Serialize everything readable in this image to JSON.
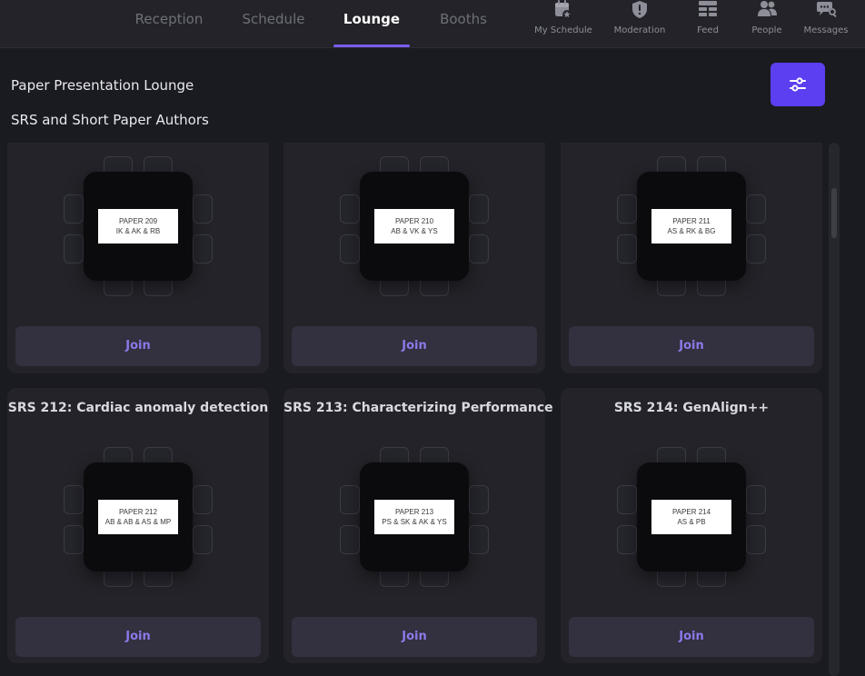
{
  "nav": {
    "tabs": [
      {
        "label": "Reception"
      },
      {
        "label": "Schedule"
      },
      {
        "label": "Lounge"
      },
      {
        "label": "Booths"
      }
    ],
    "buttons": [
      {
        "label": "My Schedule",
        "icon": "calendar-star-icon"
      },
      {
        "label": "Moderation",
        "icon": "shield-alert-icon"
      },
      {
        "label": "Feed",
        "icon": "feed-icon"
      },
      {
        "label": "People",
        "icon": "people-icon"
      },
      {
        "label": "Messages",
        "icon": "messages-icon"
      }
    ]
  },
  "header": {
    "title": "Paper Presentation Lounge",
    "subtitle": "SRS and Short Paper Authors",
    "filter_icon": "sliders-icon",
    "accent": "#5b3ff0"
  },
  "tables": [
    {
      "title": "",
      "tag_line1": "PAPER 209",
      "tag_line2": "IK & AK & RB",
      "join": "Join"
    },
    {
      "title": "",
      "tag_line1": "PAPER 210",
      "tag_line2": "AB & VK & YS",
      "join": "Join"
    },
    {
      "title": "",
      "tag_line1": "PAPER 211",
      "tag_line2": "AS & RK & BG",
      "join": "Join"
    },
    {
      "title": "SRS 212: Cardiac anomaly detection",
      "tag_line1": "PAPER 212",
      "tag_line2": "AB & AB & AS & MP",
      "join": "Join"
    },
    {
      "title": "SRS 213: Characterizing Performance",
      "tag_line1": "PAPER 213",
      "tag_line2": "PS & SK & AK & YS",
      "join": "Join"
    },
    {
      "title": "SRS 214: GenAlign++",
      "tag_line1": "PAPER 214",
      "tag_line2": "AS & PB",
      "join": "Join"
    }
  ]
}
